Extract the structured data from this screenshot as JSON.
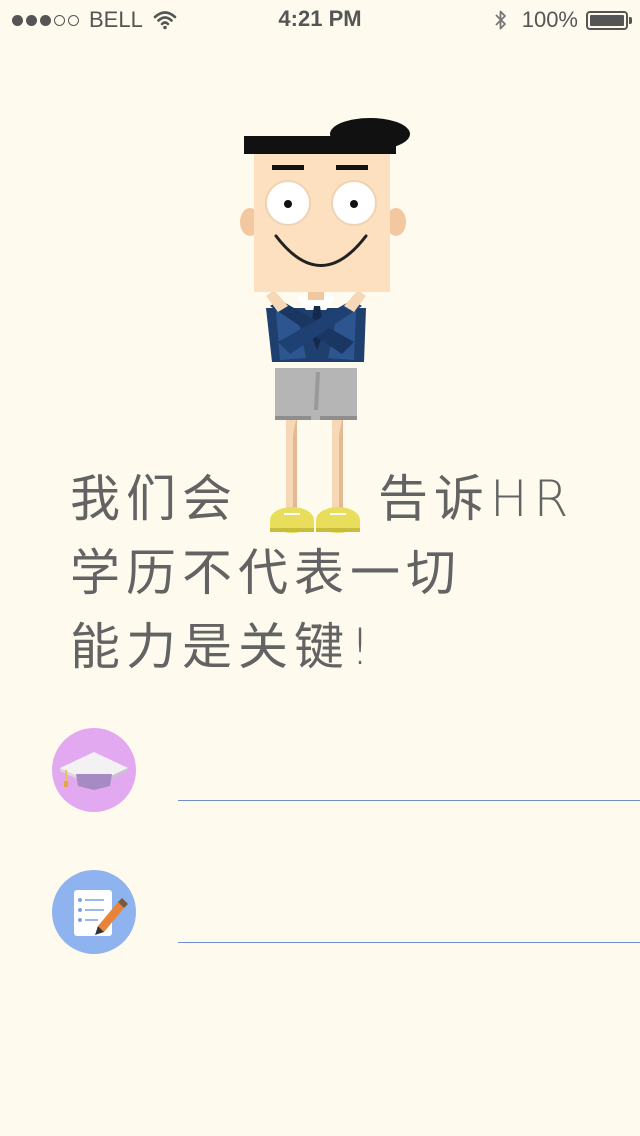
{
  "status_bar": {
    "carrier": "BELL",
    "time": "4:21 PM",
    "battery": "100%",
    "icons": [
      "signal-dots",
      "wifi-icon",
      "bluetooth-icon",
      "battery-icon"
    ]
  },
  "headline": {
    "line1_left": "我们会",
    "line1_right": "告诉HR",
    "line2": "学历不代表一切",
    "line3": "能力是关键!"
  },
  "form": {
    "education": {
      "icon": "graduation-cap-icon",
      "icon_bg": "#e2a8f0",
      "value": "",
      "placeholder": ""
    },
    "experience": {
      "icon": "notepad-pencil-icon",
      "icon_bg": "#8fb3ee",
      "value": "",
      "placeholder": ""
    }
  },
  "colors": {
    "background": "#fefbee",
    "text": "#636363",
    "underline": "#6e8fc9"
  }
}
